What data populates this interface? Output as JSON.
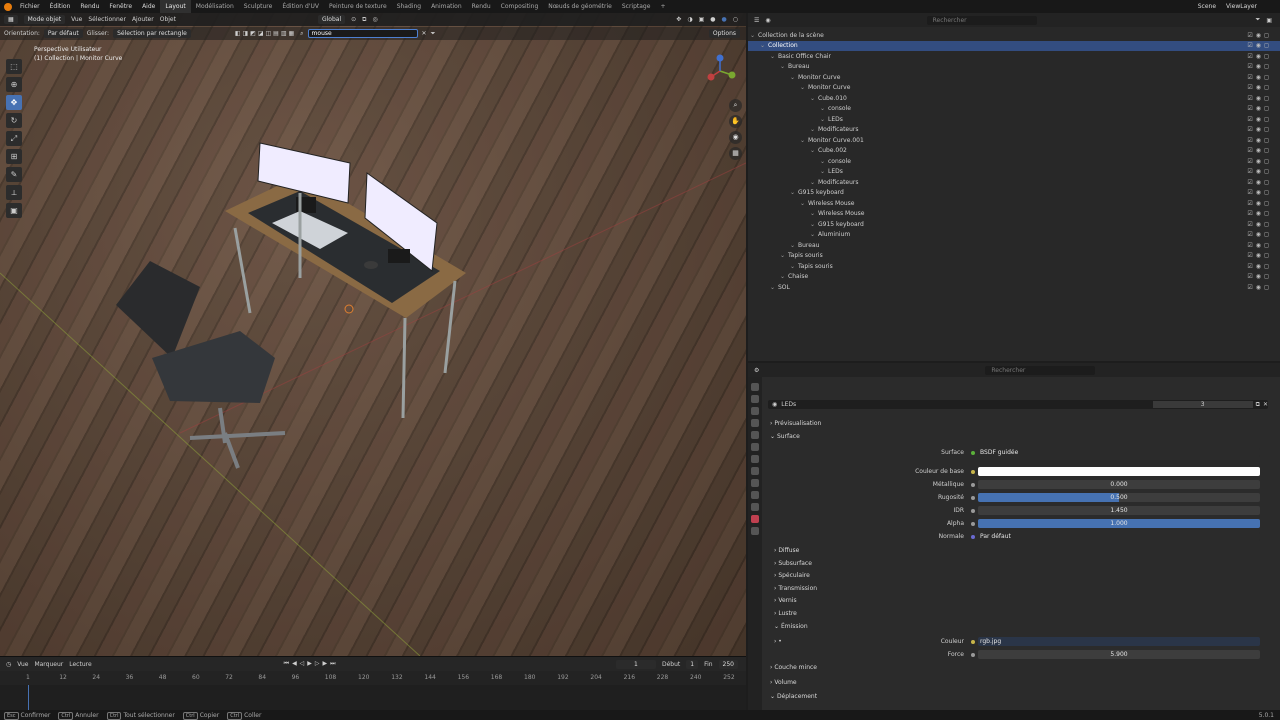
{
  "menu": {
    "items": [
      "Fichier",
      "Édition",
      "Rendu",
      "Fenêtre",
      "Aide"
    ],
    "tabs": [
      "Layout",
      "Modélisation",
      "Sculpture",
      "Édition d'UV",
      "Peinture de texture",
      "Shading",
      "Animation",
      "Rendu",
      "Compositing",
      "Nœuds de géométrie",
      "Scriptage"
    ],
    "scene": "Scene",
    "viewlayer": "ViewLayer"
  },
  "viewport": {
    "mode": "Mode objet",
    "menus": [
      "Vue",
      "Sélectionner",
      "Ajouter",
      "Objet"
    ],
    "transform": "Global",
    "orientation_label": "Orientation:",
    "orientation_value": "Par défaut",
    "drag_label": "Glisser:",
    "drag_value": "Sélection par rectangle",
    "search_value": "mouse",
    "options": "Options",
    "view_name": "Perspective Utilisateur",
    "view_sub": "(1) Collection | Monitor Curve"
  },
  "timeline": {
    "menus": [
      "Vue",
      "Marqueur",
      "Lecture"
    ],
    "current_frame": "1",
    "start_label": "Début",
    "start": "1",
    "end_label": "Fin",
    "end": "250",
    "ticks": [
      "1",
      "12",
      "24",
      "36",
      "48",
      "60",
      "72",
      "84",
      "96",
      "108",
      "120",
      "132",
      "144",
      "156",
      "168",
      "180",
      "192",
      "204",
      "216",
      "228",
      "240",
      "252"
    ]
  },
  "status": {
    "items": [
      "Confirmer",
      "Annuler",
      "Tout sélectionner",
      "Copier",
      "Coller"
    ],
    "keys": [
      "Esc",
      "Ctrl",
      "Ctrl",
      "Ctrl",
      "Ctrl"
    ],
    "version": "5.0.1"
  },
  "outliner": {
    "search_placeholder": "Rechercher",
    "rows": [
      {
        "label": "Collection de la scène",
        "indent": 0,
        "sel": false
      },
      {
        "label": "Collection",
        "indent": 1,
        "sel": true
      },
      {
        "label": "Basic Office Chair",
        "indent": 2,
        "sel": false
      },
      {
        "label": "Bureau",
        "indent": 3,
        "sel": false
      },
      {
        "label": "Monitor Curve",
        "indent": 4,
        "sel": false
      },
      {
        "label": "Monitor Curve",
        "indent": 5,
        "sel": false
      },
      {
        "label": "Cube.010",
        "indent": 6,
        "sel": false
      },
      {
        "label": "console",
        "indent": 7,
        "sel": false
      },
      {
        "label": "LEDs",
        "indent": 7,
        "sel": false
      },
      {
        "label": "Modificateurs",
        "indent": 6,
        "sel": false
      },
      {
        "label": "Monitor Curve.001",
        "indent": 5,
        "sel": false
      },
      {
        "label": "Cube.002",
        "indent": 6,
        "sel": false
      },
      {
        "label": "console",
        "indent": 7,
        "sel": false
      },
      {
        "label": "LEDs",
        "indent": 7,
        "sel": false
      },
      {
        "label": "Modificateurs",
        "indent": 6,
        "sel": false
      },
      {
        "label": "G915 keyboard",
        "indent": 4,
        "sel": false
      },
      {
        "label": "Wireless Mouse",
        "indent": 5,
        "sel": false
      },
      {
        "label": "Wireless Mouse",
        "indent": 6,
        "sel": false
      },
      {
        "label": "G915 keyboard",
        "indent": 6,
        "sel": false
      },
      {
        "label": "Aluminium",
        "indent": 6,
        "sel": false
      },
      {
        "label": "Bureau",
        "indent": 4,
        "sel": false
      },
      {
        "label": "Tapis souris",
        "indent": 3,
        "sel": false
      },
      {
        "label": "Tapis souris",
        "indent": 4,
        "sel": false
      },
      {
        "label": "Chaise",
        "indent": 3,
        "sel": false
      },
      {
        "label": "SOL",
        "indent": 2,
        "sel": false
      }
    ]
  },
  "properties": {
    "search_placeholder": "Rechercher",
    "material": "LEDs",
    "users": "3",
    "sections": {
      "preview": "Prévisualisation",
      "surface": "Surface",
      "diffuse": "Diffuse",
      "subsurface": "Subsurface",
      "specular": "Spéculaire",
      "transmission": "Transmission",
      "vernis": "Vernis",
      "lustre": "Lustre",
      "emission": "Émission",
      "couche": "Couche mince",
      "volume": "Volume",
      "displacement": "Déplacement"
    },
    "fields": {
      "surface_label": "Surface",
      "surface_value": "BSDF guidée",
      "base_color_label": "Couleur de base",
      "metallic_label": "Métallique",
      "metallic_value": "0.000",
      "roughness_label": "Rugosité",
      "roughness_value": "0.500",
      "ior_label": "IDR",
      "ior_value": "1.450",
      "alpha_label": "Alpha",
      "alpha_value": "1.000",
      "normal_label": "Normale",
      "normal_value": "Par défaut",
      "em_color_label": "Couleur",
      "em_color_value": "rgb.jpg",
      "em_strength_label": "Force",
      "em_strength_value": "5.900"
    },
    "roughness_fraction": 0.5,
    "alpha_fraction": 1.0
  },
  "colors": {
    "accent": "#4772b3",
    "selection": "#334d80",
    "base_color": "#ffffff"
  }
}
